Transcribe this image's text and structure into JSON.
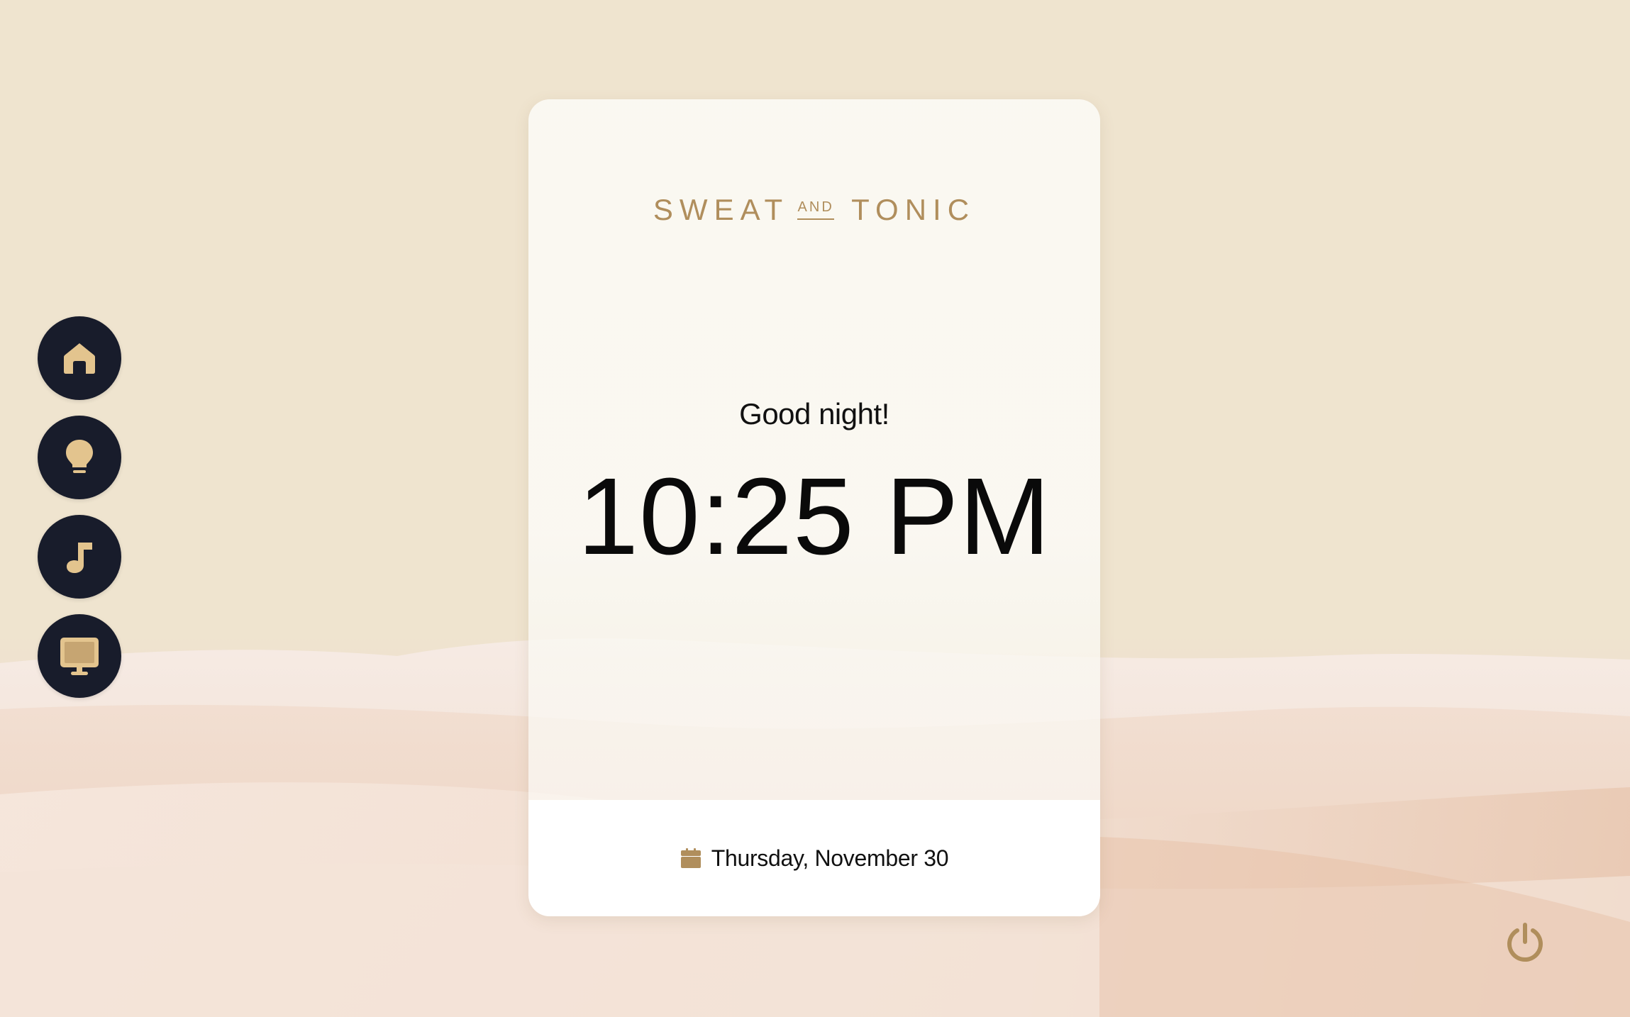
{
  "brand": {
    "word1": "SWEAT",
    "and": "AND",
    "word2": "TONIC",
    "color": "#b08e5c"
  },
  "clock": {
    "greeting": "Good night!",
    "time": "10:25 PM",
    "date": "Thursday, November 30"
  },
  "rail": {
    "items": [
      {
        "icon": "home-icon"
      },
      {
        "icon": "lightbulb-icon"
      },
      {
        "icon": "music-note-icon"
      },
      {
        "icon": "monitor-icon"
      }
    ],
    "button_color": "#181c2b",
    "icon_color": "#e3c48e"
  },
  "power": {
    "icon": "power-icon",
    "color": "#b08e5c"
  },
  "theme": {
    "background": "#efe4cf",
    "card_background": "#faf8f2"
  }
}
